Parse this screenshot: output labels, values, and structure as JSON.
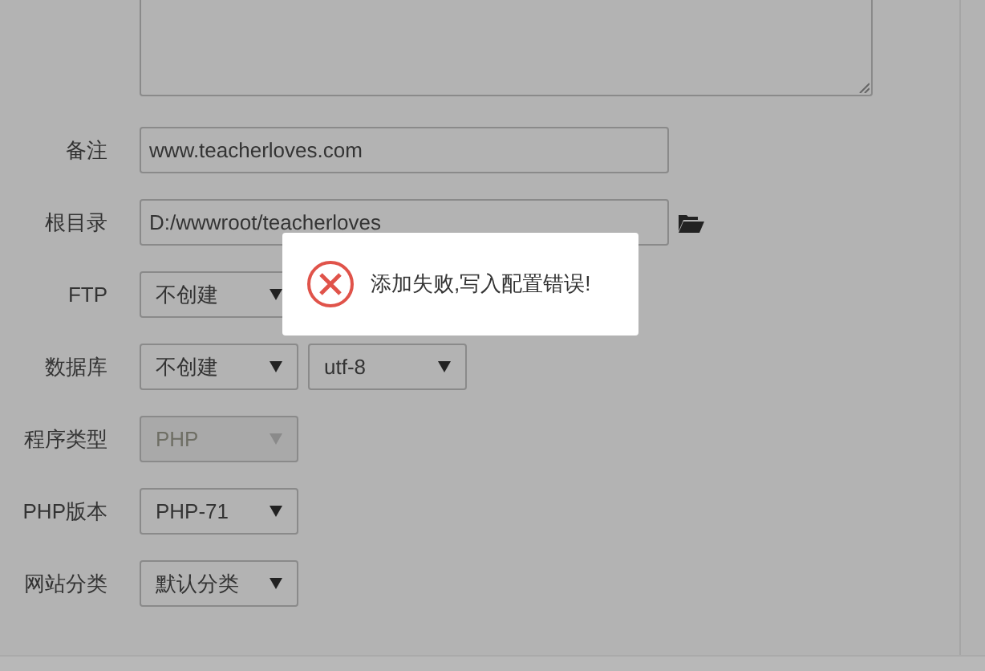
{
  "form": {
    "rows": [
      {
        "label": "备注",
        "kind": "text",
        "value": "www.teacherloves.com"
      },
      {
        "label": "根目录",
        "kind": "path",
        "value": "D:/wwwroot/teacherloves"
      },
      {
        "label": "FTP",
        "kind": "select",
        "selects": [
          {
            "value": "不创建",
            "disabled": false
          }
        ]
      },
      {
        "label": "数据库",
        "kind": "select",
        "selects": [
          {
            "value": "不创建",
            "disabled": false
          },
          {
            "value": "utf-8",
            "disabled": false
          }
        ]
      },
      {
        "label": "程序类型",
        "kind": "select",
        "selects": [
          {
            "value": "PHP",
            "disabled": true
          }
        ]
      },
      {
        "label": "PHP版本",
        "kind": "select",
        "selects": [
          {
            "value": "PHP-71",
            "disabled": false
          }
        ]
      },
      {
        "label": "网站分类",
        "kind": "select",
        "selects": [
          {
            "value": "默认分类",
            "disabled": false
          }
        ]
      }
    ]
  },
  "toast": {
    "kind": "error",
    "message": "添加失败,写入配置错误!"
  }
}
